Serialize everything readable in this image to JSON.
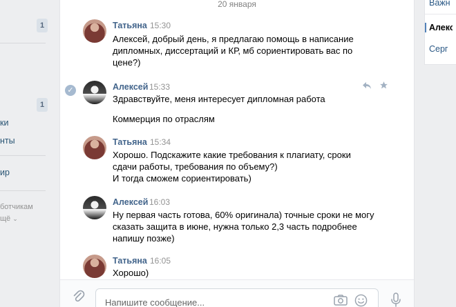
{
  "left_nav": {
    "count_top": "1",
    "count_mid": "1",
    "item_a": "ки",
    "item_b": "нты",
    "item_c": "ир",
    "footer_a": "ботчикам",
    "footer_b": "щё"
  },
  "conversation": {
    "date": "20 января",
    "messages": [
      {
        "author": "Татьяна",
        "time": "15:30",
        "lines": [
          "Алексей, добрый день, я предлагаю помощь в написание",
          "дипломных, диссертаций и КР, мб сориентировать вас по",
          "цене?)"
        ]
      },
      {
        "author": "Алексей",
        "time": "15:33",
        "lines": [
          "Здравствуйте, меня интересует дипломная работа",
          "",
          "Коммерция по отраслям"
        ]
      },
      {
        "author": "Татьяна",
        "time": "15:34",
        "lines": [
          "Хорошо. Подскажите какие требования к плагиату, сроки",
          "сдачи работы, требования по объему?)",
          "И тогда сможем сориентировать)"
        ]
      },
      {
        "author": "Алексей",
        "time": "16:03",
        "lines": [
          "Ну первая часть готова, 60% оригинала) точные сроки не могу",
          "сказать защита в июне, нужна только 2,3 часть подробнее",
          "напишу позже)"
        ]
      },
      {
        "author": "Татьяна",
        "time": "16:05",
        "lines": [
          "Хорошо)"
        ]
      }
    ]
  },
  "composer": {
    "placeholder": "Напишите сообщение..."
  },
  "right_panel": {
    "item_top": "Важн",
    "item_active": "Алекс",
    "item_bottom": "Серг"
  },
  "icons": [
    "read-check-icon",
    "reply-icon",
    "star-icon",
    "paperclip-icon",
    "camera-icon",
    "smile-icon",
    "microphone-icon"
  ]
}
